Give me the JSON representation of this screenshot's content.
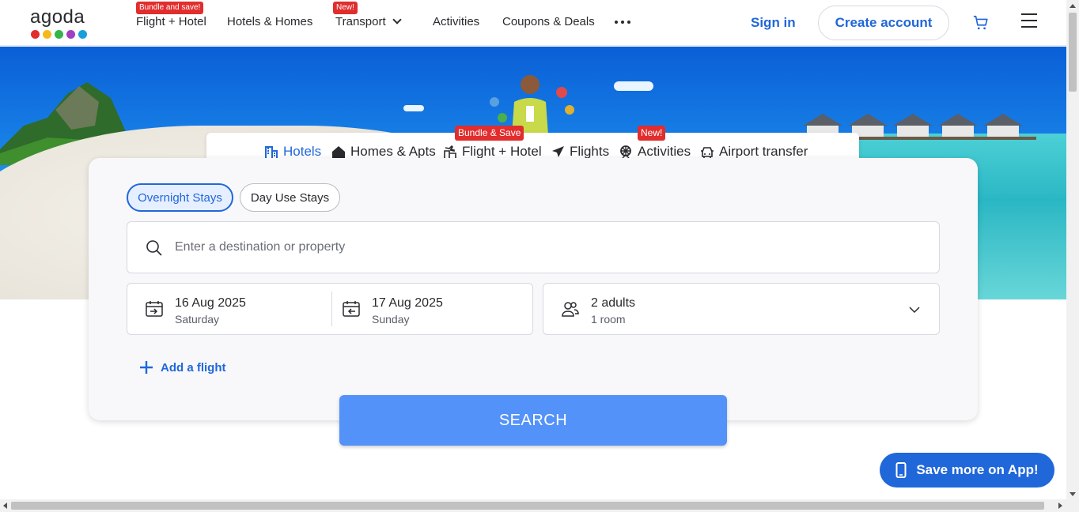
{
  "app": {
    "logo_text": "agoda",
    "logo_dot_colors": [
      "#e12d2d",
      "#f5b91b",
      "#34b44a",
      "#a03fbf",
      "#1a9fd9"
    ]
  },
  "nav": {
    "flight_hotel": {
      "label": "Flight + Hotel",
      "badge": "Bundle and save!"
    },
    "hotels_homes": {
      "label": "Hotels & Homes"
    },
    "transport": {
      "label": "Transport",
      "badge": "New!"
    },
    "activities": {
      "label": "Activities"
    },
    "coupons": {
      "label": "Coupons & Deals"
    },
    "more_icon": "more-horizontal-icon",
    "sign_in": "Sign in",
    "create_account": "Create account",
    "cart_icon": "cart-icon",
    "menu_icon": "hamburger-icon"
  },
  "tabs": {
    "hotels": {
      "label": "Hotels",
      "icon": "building-icon"
    },
    "homes": {
      "label": "Homes & Apts",
      "icon": "house-icon"
    },
    "flight_hotel": {
      "label": "Flight + Hotel",
      "icon": "bundle-icon",
      "badge": "Bundle & Save"
    },
    "flights": {
      "label": "Flights",
      "icon": "plane-icon"
    },
    "activities": {
      "label": "Activities",
      "icon": "ferris-wheel-icon",
      "badge": "New!"
    },
    "airport": {
      "label": "Airport transfer",
      "icon": "car-icon"
    }
  },
  "search": {
    "stay_types": {
      "overnight": "Overnight Stays",
      "day_use": "Day Use Stays"
    },
    "destination_placeholder": "Enter a destination or property",
    "check_in": {
      "date": "16 Aug 2025",
      "day": "Saturday"
    },
    "check_out": {
      "date": "17 Aug 2025",
      "day": "Sunday"
    },
    "guests": {
      "adults": "2 adults",
      "rooms": "1 room"
    },
    "add_flight": "Add a flight",
    "search_button": "SEARCH"
  },
  "promo": {
    "app_button": "Save more on App!"
  },
  "colors": {
    "accent": "#2067da",
    "search_button": "#5392f9",
    "badge": "#e12d2d"
  }
}
